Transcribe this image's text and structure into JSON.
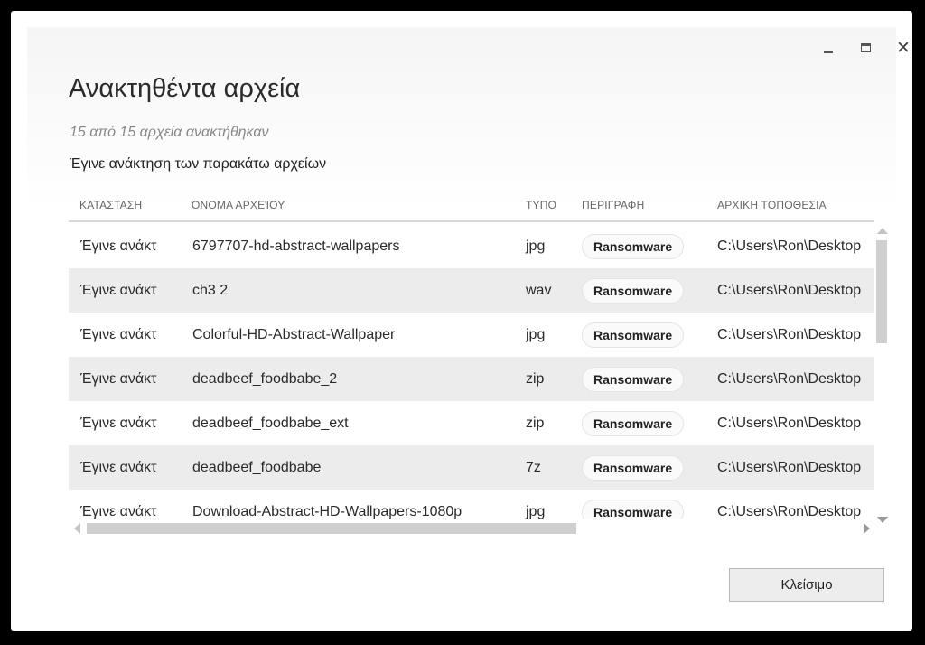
{
  "window": {
    "title": "Ανακτηθέντα αρχεία",
    "controls": {
      "minimize_icon": "minimize-icon",
      "maximize_icon": "maximize-icon",
      "close_icon": "close-icon"
    }
  },
  "summary": "15 από 15 αρχεία ανακτήθηκαν",
  "heading": "Έγινε ανάκτηση των παρακάτω αρχείων",
  "columns": {
    "status": "ΚΑΤΑΣΤΑΣΗ",
    "name": "ΌΝΟΜΑ ΑΡΧΕΊΟΥ",
    "type": "ΤΥΠΟ",
    "description": "ΠΕΡΙΓΡΑΦΗ",
    "location": "ΑΡΧΙΚΗ ΤΟΠΟΘΕΣΙΑ"
  },
  "rows": [
    {
      "status": "Έγινε ανάκτ",
      "name": "6797707-hd-abstract-wallpapers",
      "type": "jpg",
      "description": "Ransomware",
      "location": "C:\\Users\\Ron\\Desktop"
    },
    {
      "status": "Έγινε ανάκτ",
      "name": "ch3 2",
      "type": "wav",
      "description": "Ransomware",
      "location": "C:\\Users\\Ron\\Desktop"
    },
    {
      "status": "Έγινε ανάκτ",
      "name": "Colorful-HD-Abstract-Wallpaper",
      "type": "jpg",
      "description": "Ransomware",
      "location": "C:\\Users\\Ron\\Desktop"
    },
    {
      "status": "Έγινε ανάκτ",
      "name": "deadbeef_foodbabe_2",
      "type": "zip",
      "description": "Ransomware",
      "location": "C:\\Users\\Ron\\Desktop"
    },
    {
      "status": "Έγινε ανάκτ",
      "name": "deadbeef_foodbabe_ext",
      "type": "zip",
      "description": "Ransomware",
      "location": "C:\\Users\\Ron\\Desktop"
    },
    {
      "status": "Έγινε ανάκτ",
      "name": "deadbeef_foodbabe",
      "type": "7z",
      "description": "Ransomware",
      "location": "C:\\Users\\Ron\\Desktop"
    },
    {
      "status": "Έγινε ανάκτ",
      "name": "Download-Abstract-HD-Wallpapers-1080p",
      "type": "jpg",
      "description": "Ransomware",
      "location": "C:\\Users\\Ron\\Desktop"
    }
  ],
  "close_button": "Κλείσιμο"
}
